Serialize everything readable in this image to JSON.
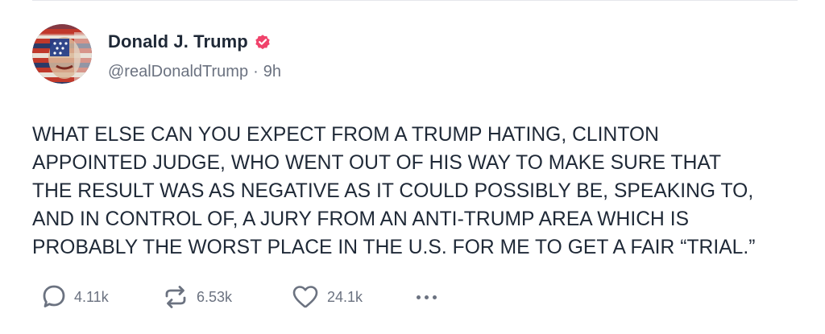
{
  "post": {
    "author": {
      "display_name": "Donald J. Trump",
      "handle": "@realDonaldTrump",
      "separator": "·",
      "time_ago": "9h",
      "verified_icon": "verified-badge-icon",
      "verified_color": "#f0436b"
    },
    "text": "WHAT ELSE CAN YOU EXPECT FROM A TRUMP HATING, CLINTON\nAPPOINTED JUDGE, WHO WENT OUT OF HIS WAY TO MAKE SURE THAT\nTHE RESULT WAS AS NEGATIVE AS IT COULD POSSIBLY BE, SPEAKING TO,\nAND IN CONTROL OF, A JURY FROM AN ANTI-TRUMP AREA WHICH IS\nPROBABLY THE WORST PLACE IN THE U.S. FOR ME TO GET A FAIR “TRIAL.”",
    "actions": {
      "replies": {
        "icon": "reply-bubble-icon",
        "count": "4.11k"
      },
      "retruths": {
        "icon": "retruth-arrows-icon",
        "count": "6.53k"
      },
      "likes": {
        "icon": "heart-icon",
        "count": "24.1k"
      },
      "more": {
        "icon": "more-dots-icon"
      }
    }
  }
}
